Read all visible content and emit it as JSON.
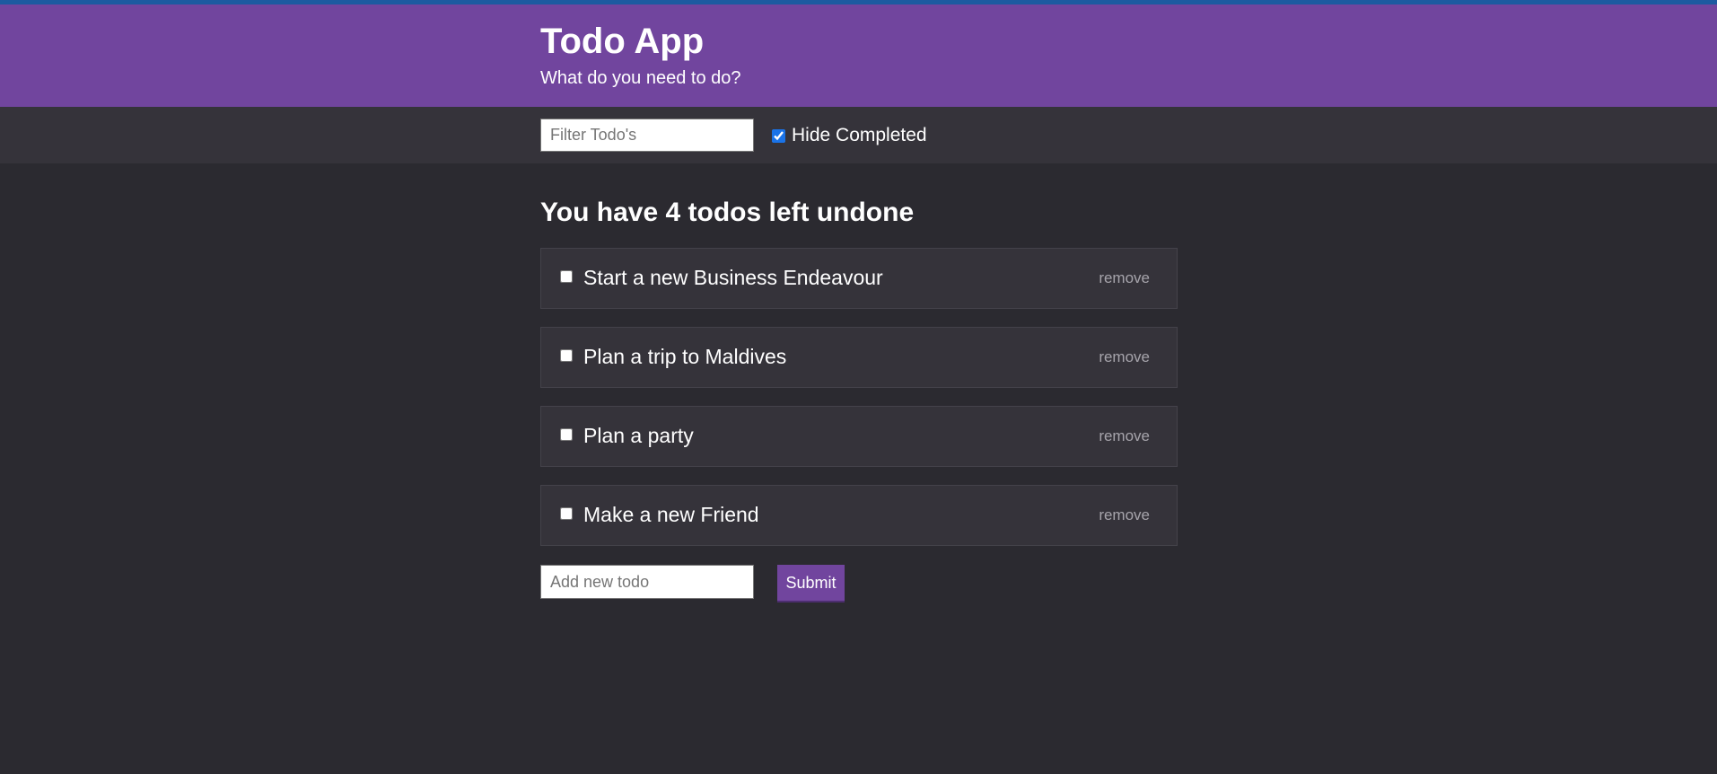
{
  "header": {
    "title": "Todo App",
    "subtitle": "What do you need to do?"
  },
  "filter": {
    "placeholder": "Filter Todo's",
    "value": "",
    "hide_completed_label": "Hide Completed",
    "hide_completed_checked": true
  },
  "summary": {
    "heading": "You have 4 todos left undone"
  },
  "todos": [
    {
      "text": "Start a new Business Endeavour",
      "done": false,
      "remove_label": "remove"
    },
    {
      "text": "Plan a trip to Maldives",
      "done": false,
      "remove_label": "remove"
    },
    {
      "text": "Plan a party",
      "done": false,
      "remove_label": "remove"
    },
    {
      "text": "Make a new Friend",
      "done": false,
      "remove_label": "remove"
    }
  ],
  "new_todo": {
    "placeholder": "Add new todo",
    "value": "",
    "submit_label": "Submit"
  },
  "colors": {
    "accent": "#71459e",
    "top_strip": "#1d5aa0",
    "background": "#2b2a30",
    "bar": "#35333a"
  }
}
